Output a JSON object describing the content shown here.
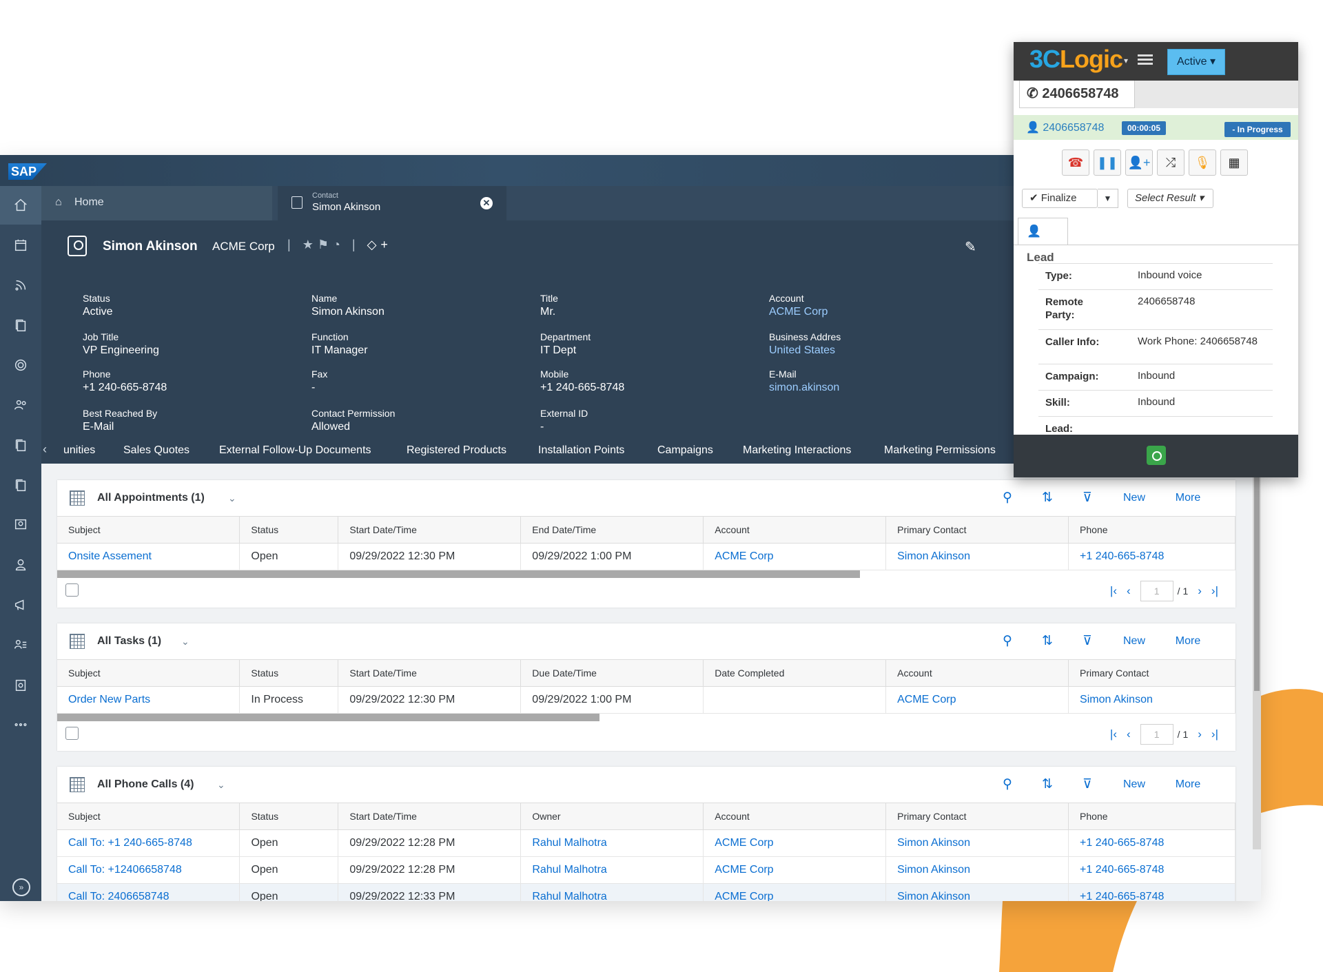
{
  "sap": {
    "logo": "SAP",
    "tabs": {
      "home_label": "Home",
      "contact_caption": "Contact",
      "contact_label": "Simon Akinson"
    },
    "header": {
      "name": "Simon Akinson",
      "account": "ACME Corp",
      "fields": [
        {
          "label": "Status",
          "value": "Active"
        },
        {
          "label": "Name",
          "value": "Simon Akinson"
        },
        {
          "label": "Title",
          "value": "Mr."
        },
        {
          "label": "Account",
          "value": "ACME Corp"
        },
        {
          "label": "Job Title",
          "value": "VP Engineering"
        },
        {
          "label": "Function",
          "value": "IT Manager"
        },
        {
          "label": "Department",
          "value": "IT Dept"
        },
        {
          "label": "Business Addres",
          "value": "United States"
        },
        {
          "label": "Phone",
          "value": "+1 240-665-8748"
        },
        {
          "label": "Fax",
          "value": "-"
        },
        {
          "label": "Mobile",
          "value": "+1 240-665-8748"
        },
        {
          "label": "E-Mail",
          "value": "simon.akinson"
        },
        {
          "label": "Best Reached By",
          "value": "E-Mail"
        },
        {
          "label": "Contact Permission",
          "value": "Allowed"
        },
        {
          "label": "External ID",
          "value": "-"
        }
      ]
    },
    "subtabs": [
      "unities",
      "Sales Quotes",
      "External Follow-Up Documents",
      "Registered Products",
      "Installation Points",
      "Campaigns",
      "Marketing Interactions",
      "Marketing Permissions"
    ],
    "toolbar": {
      "new_label": "New",
      "more_label": "More"
    },
    "appointments": {
      "title": "All Appointments",
      "count": "(1)",
      "columns": [
        "Subject",
        "Status",
        "Start Date/Time",
        "End Date/Time",
        "Account",
        "Primary Contact",
        "Phone"
      ],
      "rows": [
        [
          "Onsite Assement",
          "Open",
          "09/29/2022 12:30 PM",
          "09/29/2022 1:00 PM",
          "ACME Corp",
          "Simon Akinson",
          "+1 240-665-8748"
        ]
      ],
      "page": "1",
      "page_of": "/ 1"
    },
    "tasks": {
      "title": "All Tasks",
      "count": "(1)",
      "columns": [
        "Subject",
        "Status",
        "Start Date/Time",
        "Due Date/Time",
        "Date Completed",
        "Account",
        "Primary Contact"
      ],
      "rows": [
        [
          "Order New Parts",
          "In Process",
          "09/29/2022 12:30 PM",
          "09/29/2022 1:00 PM",
          "",
          "ACME Corp",
          "Simon Akinson"
        ]
      ],
      "page": "1",
      "page_of": "/ 1"
    },
    "phone_calls": {
      "title": "All Phone Calls",
      "count": "(4)",
      "columns": [
        "Subject",
        "Status",
        "Start Date/Time",
        "Owner",
        "Account",
        "Primary Contact",
        "Phone"
      ],
      "rows": [
        [
          "Call To: +1 240-665-8748",
          "Open",
          "09/29/2022 12:28 PM",
          "Rahul Malhotra",
          "ACME Corp",
          "Simon Akinson",
          "+1 240-665-8748"
        ],
        [
          "Call To: +12406658748",
          "Open",
          "09/29/2022 12:28 PM",
          "Rahul Malhotra",
          "ACME Corp",
          "Simon Akinson",
          "+1 240-665-8748"
        ],
        [
          "Call To: 2406658748",
          "Open",
          "09/29/2022 12:33 PM",
          "Rahul Malhotra",
          "ACME Corp",
          "Simon Akinson",
          "+1 240-665-8748"
        ]
      ]
    }
  },
  "cti": {
    "logo_a": "3C",
    "logo_b": "Logic",
    "status": "Active",
    "number_tab": "2406658748",
    "call_number": "2406658748",
    "timer": "00:00:05",
    "call_state": "- In Progress",
    "finalize_label": "Finalize",
    "select_result": "Select Result",
    "lead_tab": "Lead",
    "details": [
      {
        "label": "Type:",
        "value": "Inbound voice"
      },
      {
        "label": "Remote Party:",
        "value": "2406658748"
      },
      {
        "label": "Caller Info:",
        "value": "Work Phone: 2406658748"
      },
      {
        "label": "Campaign:",
        "value": "Inbound"
      },
      {
        "label": "Skill:",
        "value": "Inbound"
      },
      {
        "label": "Lead:",
        "value": ""
      }
    ],
    "colors": {
      "brand_blue": "#27a6e2",
      "brand_orange": "#f7a21b",
      "hangup": "#d9342b"
    }
  },
  "colors": {
    "sap_shell": "#354a5f",
    "sap_header": "#2f4255",
    "link": "#0a6ed1",
    "accent_orange": "#f5a33b"
  }
}
